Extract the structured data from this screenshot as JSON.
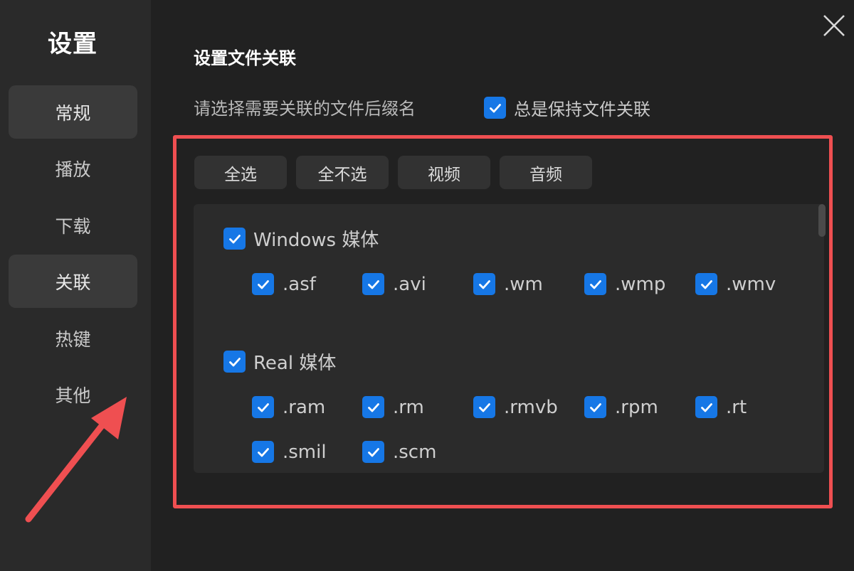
{
  "sidebar": {
    "title": "设置",
    "items": [
      {
        "label": "常规",
        "active": true
      },
      {
        "label": "播放",
        "active": false
      },
      {
        "label": "下载",
        "active": false
      },
      {
        "label": "关联",
        "active": true
      },
      {
        "label": "热键",
        "active": false
      },
      {
        "label": "其他",
        "active": false
      }
    ]
  },
  "main": {
    "title": "设置文件关联",
    "prompt": "请选择需要关联的文件后缀名",
    "keep_option": {
      "label": "总是保持文件关联",
      "checked": true
    }
  },
  "toolbar": {
    "select_all": "全选",
    "select_none": "全不选",
    "video": "视频",
    "audio": "音频"
  },
  "groups": [
    {
      "label": "Windows 媒体",
      "checked": true,
      "extensions": [
        ".asf",
        ".avi",
        ".wm",
        ".wmp",
        ".wmv"
      ]
    },
    {
      "label": "Real 媒体",
      "checked": true,
      "extensions": [
        ".ram",
        ".rm",
        ".rmvb",
        ".rpm",
        ".rt",
        ".smil",
        ".scm"
      ]
    }
  ],
  "colors": {
    "accent": "#1677e6",
    "highlight": "#ef4f51",
    "background": "#212121",
    "sidebar": "#2a2a2a"
  },
  "icons": {
    "close": "close-icon",
    "check": "checkmark-icon",
    "annotation": "red-arrow-annotation"
  }
}
